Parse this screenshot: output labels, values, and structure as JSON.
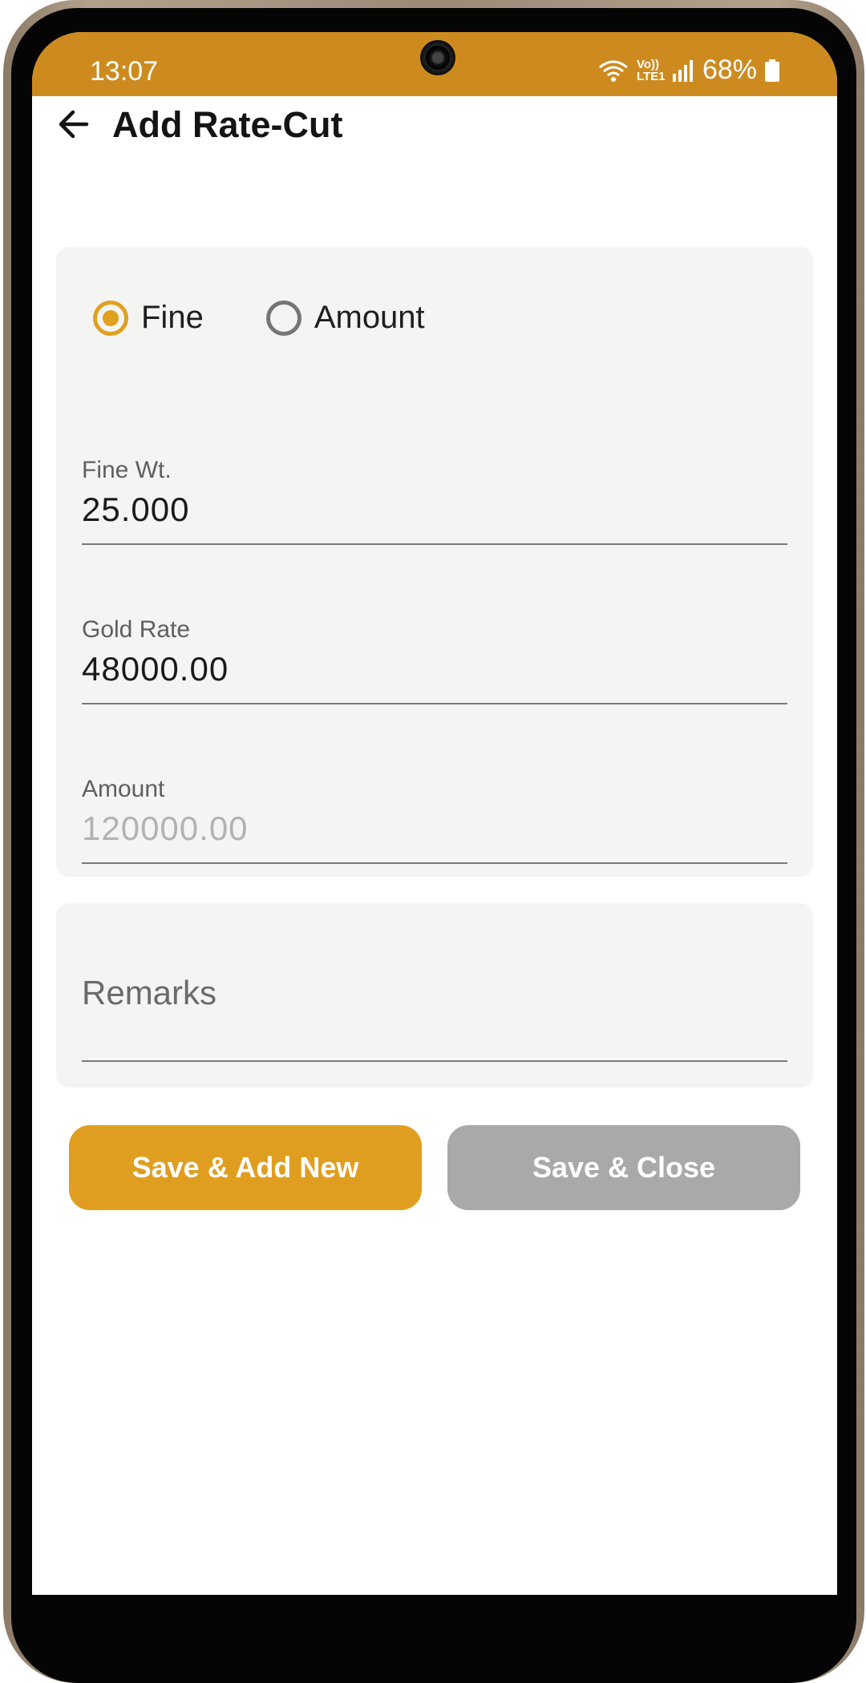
{
  "status_bar": {
    "time": "13:07",
    "network": "Vo)) LTE1",
    "battery": "68%",
    "color": "#cd8b1f"
  },
  "header": {
    "title": "Add Rate-Cut",
    "back_icon": "arrow-left-icon"
  },
  "form": {
    "radio_options": [
      {
        "label": "Fine",
        "selected": true
      },
      {
        "label": "Amount",
        "selected": false
      }
    ],
    "fine_wt": {
      "label": "Fine Wt.",
      "value": "25.000"
    },
    "gold_rate": {
      "label": "Gold Rate",
      "value": "48000.00"
    },
    "amount": {
      "label": "Amount",
      "value": "120000.00"
    },
    "remarks": {
      "placeholder": "Remarks"
    }
  },
  "buttons": {
    "save_add_new": "Save & Add New",
    "save_close": "Save & Close"
  },
  "colors": {
    "accent": "#e09e20",
    "disabled_button": "#a9a9a9",
    "card_background": "#f4f4f3"
  }
}
